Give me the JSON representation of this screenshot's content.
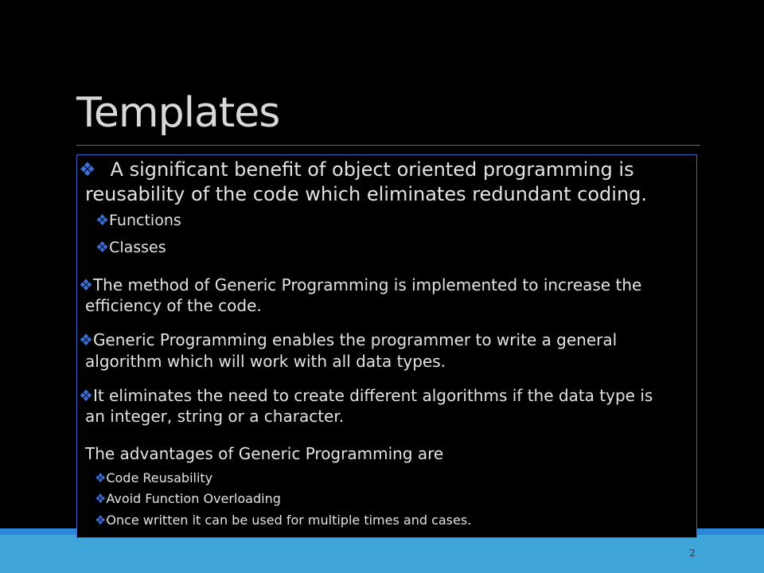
{
  "slide": {
    "title": "Templates",
    "page_number": "2",
    "bullet_glyph": "❖",
    "colors": {
      "background": "#000000",
      "accent_band": "#3fa4d8",
      "accent_band_dark": "#2e86d9",
      "bullet": "#3a6fd8",
      "box_border": "#3a63c8",
      "text": "#e3e3e3"
    }
  },
  "content": {
    "intro_line1": "A significant benefit of object oriented programming is",
    "intro_line2": "reusability of  the code which eliminates redundant coding.",
    "sub_items": [
      "Functions",
      "Classes"
    ],
    "point1_line1": "The method of Generic Programming is implemented to increase the",
    "point1_line2": "efficiency of the code.",
    "point2_line1": "Generic Programming enables the programmer to write a general",
    "point2_line2": "algorithm which will work with all data types.",
    "point3_line1": "It eliminates the need to create different algorithms if the data type is",
    "point3_line2": "an integer, string or a character.",
    "advantages_heading": "The advantages of Generic Programming are",
    "advantages": [
      "Code Reusability",
      "Avoid Function Overloading",
      "Once written it can be used for multiple times and cases."
    ]
  }
}
